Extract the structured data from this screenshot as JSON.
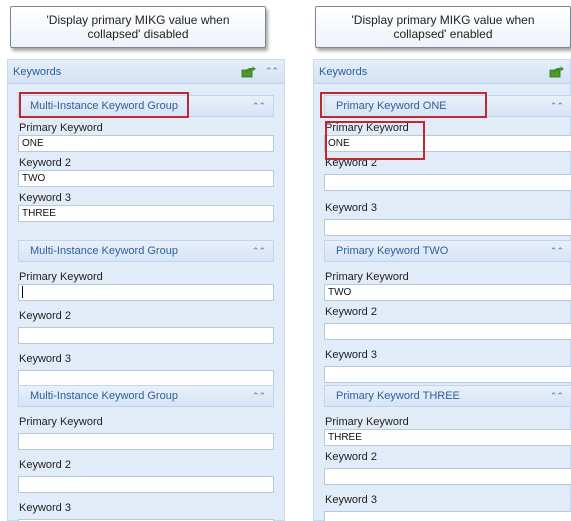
{
  "callouts": [
    {
      "line1": "'Display primary MIKG value when",
      "line2": "collapsed' disabled"
    },
    {
      "line1": "'Display primary MIKG value when",
      "line2": "collapsed' enabled"
    }
  ],
  "panels": [
    {
      "title": "Keywords",
      "groups": [
        {
          "title": "Multi-Instance Keyword Group",
          "fields": [
            {
              "label": "Primary Keyword",
              "value": "ONE"
            },
            {
              "label": "Keyword 2",
              "value": "TWO"
            },
            {
              "label": "Keyword 3",
              "value": "THREE"
            }
          ]
        },
        {
          "title": "Multi-Instance Keyword Group",
          "fields": [
            {
              "label": "Primary Keyword",
              "value": ""
            },
            {
              "label": "Keyword 2",
              "value": ""
            },
            {
              "label": "Keyword 3",
              "value": ""
            }
          ]
        },
        {
          "title": "Multi-Instance Keyword Group",
          "fields": [
            {
              "label": "Primary Keyword",
              "value": ""
            },
            {
              "label": "Keyword 2",
              "value": ""
            },
            {
              "label": "Keyword 3",
              "value": ""
            }
          ]
        }
      ]
    },
    {
      "title": "Keywords",
      "groups": [
        {
          "title": "Primary Keyword ONE",
          "fields": [
            {
              "label": "Primary Keyword",
              "value": "ONE"
            },
            {
              "label": "Keyword 2",
              "value": ""
            },
            {
              "label": "Keyword 3",
              "value": ""
            }
          ]
        },
        {
          "title": "Primary Keyword TWO",
          "fields": [
            {
              "label": "Primary Keyword",
              "value": "TWO"
            },
            {
              "label": "Keyword 2",
              "value": ""
            },
            {
              "label": "Keyword 3",
              "value": ""
            }
          ]
        },
        {
          "title": "Primary Keyword THREE",
          "fields": [
            {
              "label": "Primary Keyword",
              "value": "THREE"
            },
            {
              "label": "Keyword 2",
              "value": ""
            },
            {
              "label": "Keyword 3",
              "value": ""
            }
          ]
        }
      ]
    }
  ],
  "icons": {
    "header_action": "folder-arrow-icon",
    "collapse": "double-chevron-up-icon"
  },
  "colors": {
    "panel_bg": "#e2ecf8",
    "header_text": "#2d5f98",
    "highlight": "#c1272d"
  }
}
